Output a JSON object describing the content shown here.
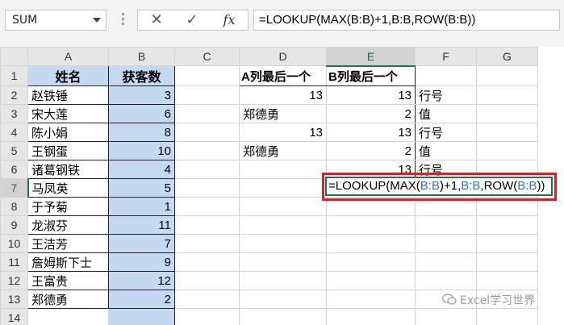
{
  "formula_bar": {
    "name_box": "SUM",
    "cancel_glyph": "✕",
    "confirm_glyph": "✓",
    "fx_label": "fx",
    "formula": "=LOOKUP(MAX(B:B)+1,B:B,ROW(B:B))"
  },
  "columns": [
    "A",
    "B",
    "C",
    "D",
    "E",
    "F",
    "G"
  ],
  "rows": [
    "1",
    "2",
    "3",
    "4",
    "5",
    "6",
    "7",
    "8",
    "9",
    "10",
    "11",
    "12",
    "13",
    "14"
  ],
  "headers": {
    "name": "姓名",
    "customers": "获客数"
  },
  "names": [
    "赵铁锤",
    "宋大莲",
    "陈小娟",
    "王钢蛋",
    "诸葛钢铁",
    "马凤英",
    "于予菊",
    "龙淑芬",
    "王洁芳",
    "詹姆斯下士",
    "王富贵",
    "郑德勇"
  ],
  "counts": [
    "3",
    "6",
    "8",
    "10",
    "4",
    "5",
    "1",
    "11",
    "7",
    "9",
    "12",
    "2"
  ],
  "results": {
    "d1": "A列最后一个",
    "e1": "B列最后一个",
    "d2": "13",
    "e2": "13",
    "f2": "行号",
    "d3": "郑德勇",
    "e3": "2",
    "f3": "值",
    "d4": "13",
    "e4": "13",
    "f4": "行号",
    "d5": "郑德勇",
    "e5": "2",
    "f5": "值",
    "e6": "13",
    "f6": "行号"
  },
  "edit_cell": {
    "p1": "=LOOKUP(MAX(",
    "r1": "B:B",
    "p2": ")+1,",
    "r2": "B:B",
    "p3": ",ROW(",
    "r3": "B:B",
    "p4": "))"
  },
  "watermark": {
    "text": "Excel学习世界",
    "icon": "wechat-icon"
  },
  "colors": {
    "selection_green": "#217346",
    "highlight_blue": "#c5d9f1",
    "annotation_red": "#e31b23",
    "reference_blue": "#2e6fd0"
  }
}
